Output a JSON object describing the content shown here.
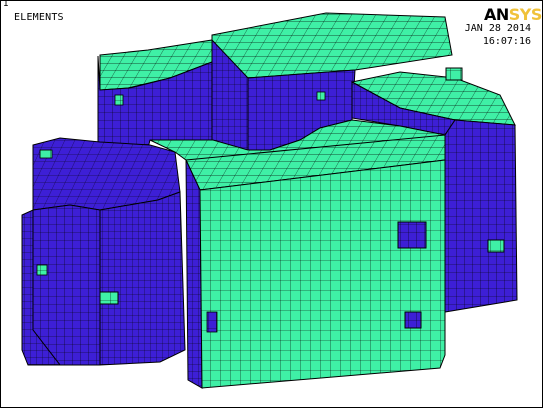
{
  "window_number": "1",
  "plot_title": "ELEMENTS",
  "logo": {
    "main": "AN",
    "accent": "SYS"
  },
  "timestamp": {
    "date": "JAN 28 2014",
    "time": "16:07:16"
  },
  "colors": {
    "element_face_blue": "#3d1fd6",
    "element_face_green": "#3ff0a6",
    "mesh_lines": "#000000",
    "background": "#ffffff",
    "logo_accent": "#f0c23a"
  }
}
